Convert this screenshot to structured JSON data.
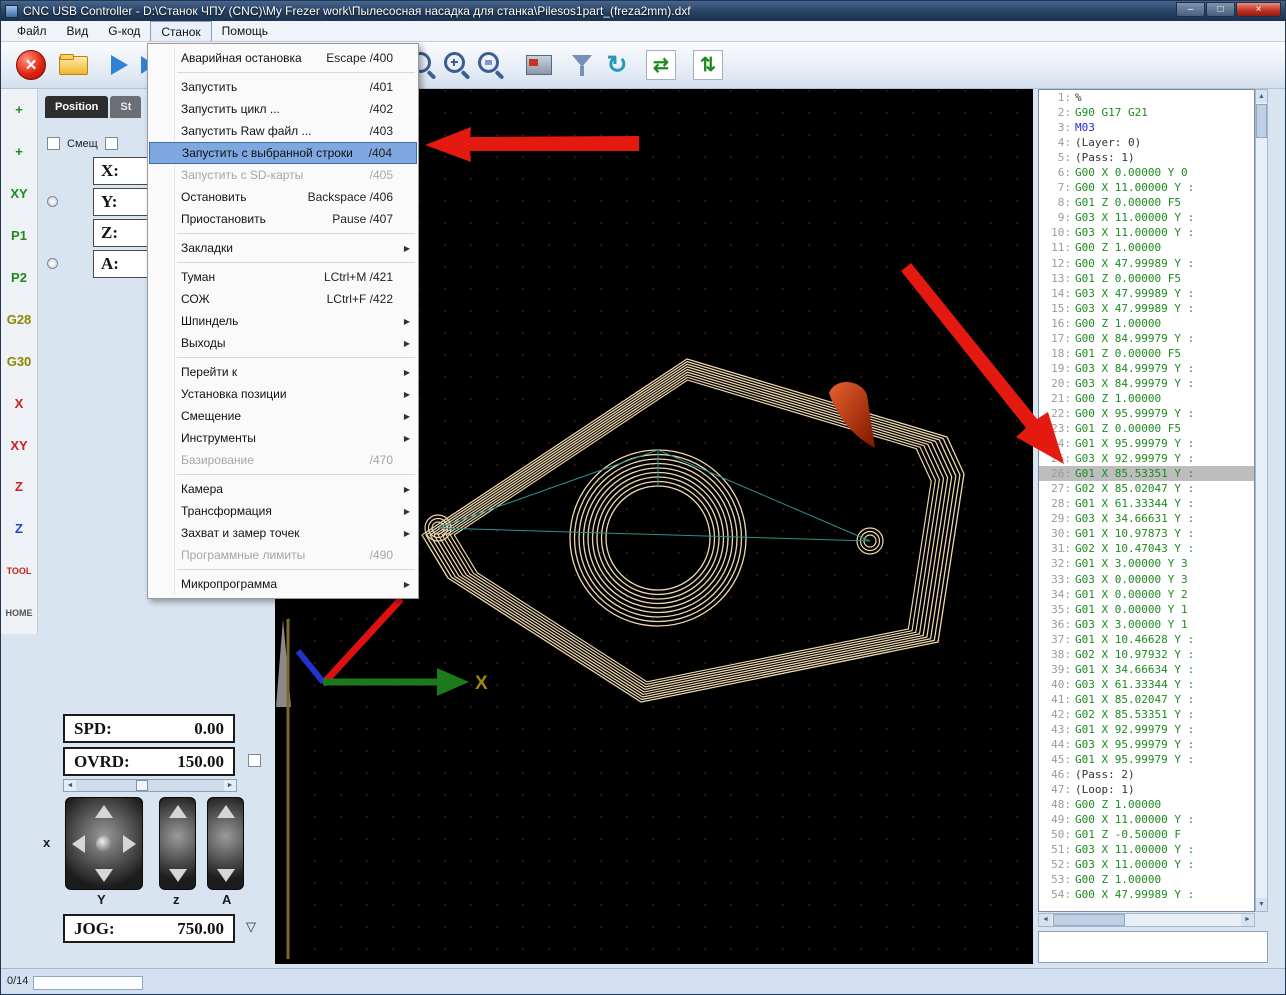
{
  "window": {
    "title": "CNC USB Controller - D:\\Станок ЧПУ (CNC)\\My Frezer work\\Пылесосная насадка для станка\\Pilesos1part_(freza2mm).dxf",
    "controls": {
      "minimize": "–",
      "maximize": "□",
      "close": "×"
    }
  },
  "menubar": {
    "items": [
      {
        "label": "Файл"
      },
      {
        "label": "Вид"
      },
      {
        "label": "G-код"
      },
      {
        "label": "Станок",
        "active": true
      },
      {
        "label": "Помощь"
      }
    ]
  },
  "machine_menu": {
    "items": [
      {
        "label": "Аварийная остановка",
        "shortcut": "Escape /400"
      },
      {
        "sep": true
      },
      {
        "label": "Запустить",
        "shortcut": "/401"
      },
      {
        "label": "Запустить цикл ...",
        "shortcut": "/402"
      },
      {
        "label": "Запустить Raw файл ...",
        "shortcut": "/403"
      },
      {
        "label": "Запустить с выбранной строки",
        "shortcut": "/404",
        "highlighted": true
      },
      {
        "label": "Запустить с SD-карты",
        "shortcut": "/405",
        "disabled": true
      },
      {
        "label": "Остановить",
        "shortcut": "Backspace /406"
      },
      {
        "label": "Приостановить",
        "shortcut": "Pause /407"
      },
      {
        "sep": true
      },
      {
        "label": "Закладки",
        "submenu": true
      },
      {
        "sep": true
      },
      {
        "label": "Туман",
        "shortcut": "LCtrl+M /421"
      },
      {
        "label": "СОЖ",
        "shortcut": "LCtrl+F /422"
      },
      {
        "label": "Шпиндель",
        "submenu": true
      },
      {
        "label": "Выходы",
        "submenu": true
      },
      {
        "sep": true
      },
      {
        "label": "Перейти к",
        "submenu": true
      },
      {
        "label": "Установка позиции",
        "submenu": true
      },
      {
        "label": "Смещение",
        "submenu": true
      },
      {
        "label": "Инструменты",
        "submenu": true
      },
      {
        "label": "Базирование",
        "shortcut": "/470",
        "disabled": true
      },
      {
        "sep": true
      },
      {
        "label": "Камера",
        "submenu": true
      },
      {
        "label": "Трансформация",
        "submenu": true
      },
      {
        "label": "Захват и замер точек",
        "submenu": true
      },
      {
        "label": "Программные лимиты",
        "shortcut": "/490",
        "disabled": true
      },
      {
        "sep": true
      },
      {
        "label": "Микропрограмма",
        "submenu": true
      }
    ]
  },
  "toolbar": {
    "icons": [
      {
        "name": "emergency-stop-button",
        "icon": "ti-stop"
      },
      {
        "name": "open-file-button",
        "icon": "ti-folder"
      },
      {
        "name": "start-button",
        "icon": "ti-play"
      },
      {
        "name": "start-alt-button",
        "icon": "ti-play2"
      },
      {
        "name": "zoom-fit-button",
        "icon": "ti-zoom"
      },
      {
        "name": "zoom-in-button",
        "icon": "ti-zoomin"
      },
      {
        "name": "zoom-window-button",
        "icon": "ti-zoomwin"
      },
      {
        "name": "simulation-button",
        "icon": "ti-sim"
      },
      {
        "name": "filter-button",
        "icon": "ti-filter"
      },
      {
        "name": "rotate-view-button",
        "icon": "ti-rotate"
      },
      {
        "name": "toolpath-view-button",
        "icon": "ti-path1"
      },
      {
        "name": "rapids-view-button",
        "icon": "ti-path2"
      }
    ]
  },
  "sidebar": {
    "items": [
      {
        "name": "jog-mode-icon",
        "label": "+",
        "cls": "green"
      },
      {
        "name": "jog-step-icon",
        "label": "+",
        "cls": "green"
      },
      {
        "name": "goto-xy-zero-icon",
        "label": "XY",
        "cls": "green"
      },
      {
        "name": "goto-p1-icon",
        "label": "P1",
        "cls": "green"
      },
      {
        "name": "goto-p2-icon",
        "label": "P2",
        "cls": "green"
      },
      {
        "name": "goto-g28-icon",
        "label": "G28",
        "cls": "olive"
      },
      {
        "name": "goto-g30-icon",
        "label": "G30",
        "cls": "olive"
      },
      {
        "name": "zero-x-icon",
        "label": "X",
        "cls": "red"
      },
      {
        "name": "zero-xy-icon",
        "label": "XY",
        "cls": "red"
      },
      {
        "name": "zero-z-icon",
        "label": "Z",
        "cls": "red"
      },
      {
        "name": "measure-z-icon",
        "label": "Z",
        "cls": "blue"
      },
      {
        "name": "tool-change-icon",
        "label": "TOOL",
        "cls": "red",
        "sm": true
      },
      {
        "name": "home-icon",
        "label": "HOME",
        "cls": "gray",
        "sm": true
      }
    ]
  },
  "position_panel": {
    "tabs": [
      {
        "label": "Position",
        "active": true
      },
      {
        "label": "St"
      }
    ],
    "offset_label": "Смещ",
    "axes": [
      {
        "label": "X:"
      },
      {
        "label": "Y:",
        "radio": true
      },
      {
        "label": "Z:"
      },
      {
        "label": "A:",
        "radio": true
      }
    ]
  },
  "view": {
    "axis_label_x": "X"
  },
  "gcode": {
    "lines": [
      {
        "n": 1,
        "t": "%",
        "c": "p"
      },
      {
        "n": 2,
        "t": "G90 G17 G21",
        "c": "g"
      },
      {
        "n": 3,
        "t": "M03",
        "c": "m"
      },
      {
        "n": 4,
        "t": "(Layer: 0)",
        "c": "c"
      },
      {
        "n": 5,
        "t": "(Pass: 1)",
        "c": "c"
      },
      {
        "n": 6,
        "t": "G00 X 0.00000 Y 0",
        "c": "g"
      },
      {
        "n": 7,
        "t": "G00 X 11.00000 Y :",
        "c": "g"
      },
      {
        "n": 8,
        "t": "G01 Z 0.00000 F5",
        "c": "g"
      },
      {
        "n": 9,
        "t": "G03 X 11.00000 Y :",
        "c": "g"
      },
      {
        "n": 10,
        "t": "G03 X 11.00000 Y :",
        "c": "g"
      },
      {
        "n": 11,
        "t": "G00 Z 1.00000",
        "c": "g"
      },
      {
        "n": 12,
        "t": "G00 X 47.99989 Y :",
        "c": "g"
      },
      {
        "n": 13,
        "t": "G01 Z 0.00000 F5",
        "c": "g"
      },
      {
        "n": 14,
        "t": "G03 X 47.99989 Y :",
        "c": "g"
      },
      {
        "n": 15,
        "t": "G03 X 47.99989 Y :",
        "c": "g"
      },
      {
        "n": 16,
        "t": "G00 Z 1.00000",
        "c": "g"
      },
      {
        "n": 17,
        "t": "G00 X 84.99979 Y :",
        "c": "g"
      },
      {
        "n": 18,
        "t": "G01 Z 0.00000 F5",
        "c": "g"
      },
      {
        "n": 19,
        "t": "G03 X 84.99979 Y :",
        "c": "g"
      },
      {
        "n": 20,
        "t": "G03 X 84.99979 Y :",
        "c": "g"
      },
      {
        "n": 21,
        "t": "G00 Z 1.00000",
        "c": "g"
      },
      {
        "n": 22,
        "t": "G00 X 95.99979 Y :",
        "c": "g"
      },
      {
        "n": 23,
        "t": "G01 Z 0.00000 F5",
        "c": "g"
      },
      {
        "n": 24,
        "t": "G01 X 95.99979 Y :",
        "c": "g"
      },
      {
        "n": 25,
        "t": "G03 X 92.99979 Y :",
        "c": "g"
      },
      {
        "n": 26,
        "t": "G01 X 85.53351 Y :",
        "c": "g",
        "sel": true
      },
      {
        "n": 27,
        "t": "G02 X 85.02047 Y :",
        "c": "g"
      },
      {
        "n": 28,
        "t": "G01 X 61.33344 Y :",
        "c": "g"
      },
      {
        "n": 29,
        "t": "G03 X 34.66631 Y :",
        "c": "g"
      },
      {
        "n": 30,
        "t": "G01 X 10.97873 Y :",
        "c": "g"
      },
      {
        "n": 31,
        "t": "G02 X 10.47043 Y :",
        "c": "g"
      },
      {
        "n": 32,
        "t": "G01 X 3.00000 Y 3",
        "c": "g"
      },
      {
        "n": 33,
        "t": "G03 X 0.00000 Y 3",
        "c": "g"
      },
      {
        "n": 34,
        "t": "G01 X 0.00000 Y 2",
        "c": "g"
      },
      {
        "n": 35,
        "t": "G01 X 0.00000 Y 1",
        "c": "g"
      },
      {
        "n": 36,
        "t": "G03 X 3.00000 Y 1",
        "c": "g"
      },
      {
        "n": 37,
        "t": "G01 X 10.46628 Y :",
        "c": "g"
      },
      {
        "n": 38,
        "t": "G02 X 10.97932 Y :",
        "c": "g"
      },
      {
        "n": 39,
        "t": "G01 X 34.66634 Y :",
        "c": "g"
      },
      {
        "n": 40,
        "t": "G03 X 61.33344 Y :",
        "c": "g"
      },
      {
        "n": 41,
        "t": "G01 X 85.02047 Y :",
        "c": "g"
      },
      {
        "n": 42,
        "t": "G02 X 85.53351 Y :",
        "c": "g"
      },
      {
        "n": 43,
        "t": "G01 X 92.99979 Y :",
        "c": "g"
      },
      {
        "n": 44,
        "t": "G03 X 95.99979 Y :",
        "c": "g"
      },
      {
        "n": 45,
        "t": "G01 X 95.99979 Y :",
        "c": "g"
      },
      {
        "n": 46,
        "t": "(Pass: 2)",
        "c": "c"
      },
      {
        "n": 47,
        "t": "(Loop: 1)",
        "c": "c"
      },
      {
        "n": 48,
        "t": "G00 Z 1.00000",
        "c": "g"
      },
      {
        "n": 49,
        "t": "G00 X 11.00000 Y :",
        "c": "g"
      },
      {
        "n": 50,
        "t": "G01 Z -0.50000 F",
        "c": "g"
      },
      {
        "n": 51,
        "t": "G03 X 11.00000 Y :",
        "c": "g"
      },
      {
        "n": 52,
        "t": "G03 X 11.00000 Y :",
        "c": "g"
      },
      {
        "n": 53,
        "t": "G00 Z 1.00000",
        "c": "g"
      },
      {
        "n": 54,
        "t": "G00 X 47.99989 Y :",
        "c": "g"
      }
    ]
  },
  "controls": {
    "spd_label": "SPD:",
    "spd_value": "0.00",
    "ovrd_label": "OVRD:",
    "ovrd_value": "150.00",
    "jog_label": "JOG:",
    "jog_value": "750.00",
    "pad_labels": {
      "x": "x",
      "y": "Y",
      "z": "z",
      "a": "A"
    }
  },
  "statusbar": {
    "progress_text": "0/14"
  },
  "colors": {
    "gcode_green": "#1e8a1e",
    "mcode_blue": "#2a2ad0",
    "toolpath_wheat": "#efd9ae",
    "annotation_red": "#e41910",
    "selection_gray": "#bdbdbd",
    "menu_highlight": "#7fa8e0"
  }
}
